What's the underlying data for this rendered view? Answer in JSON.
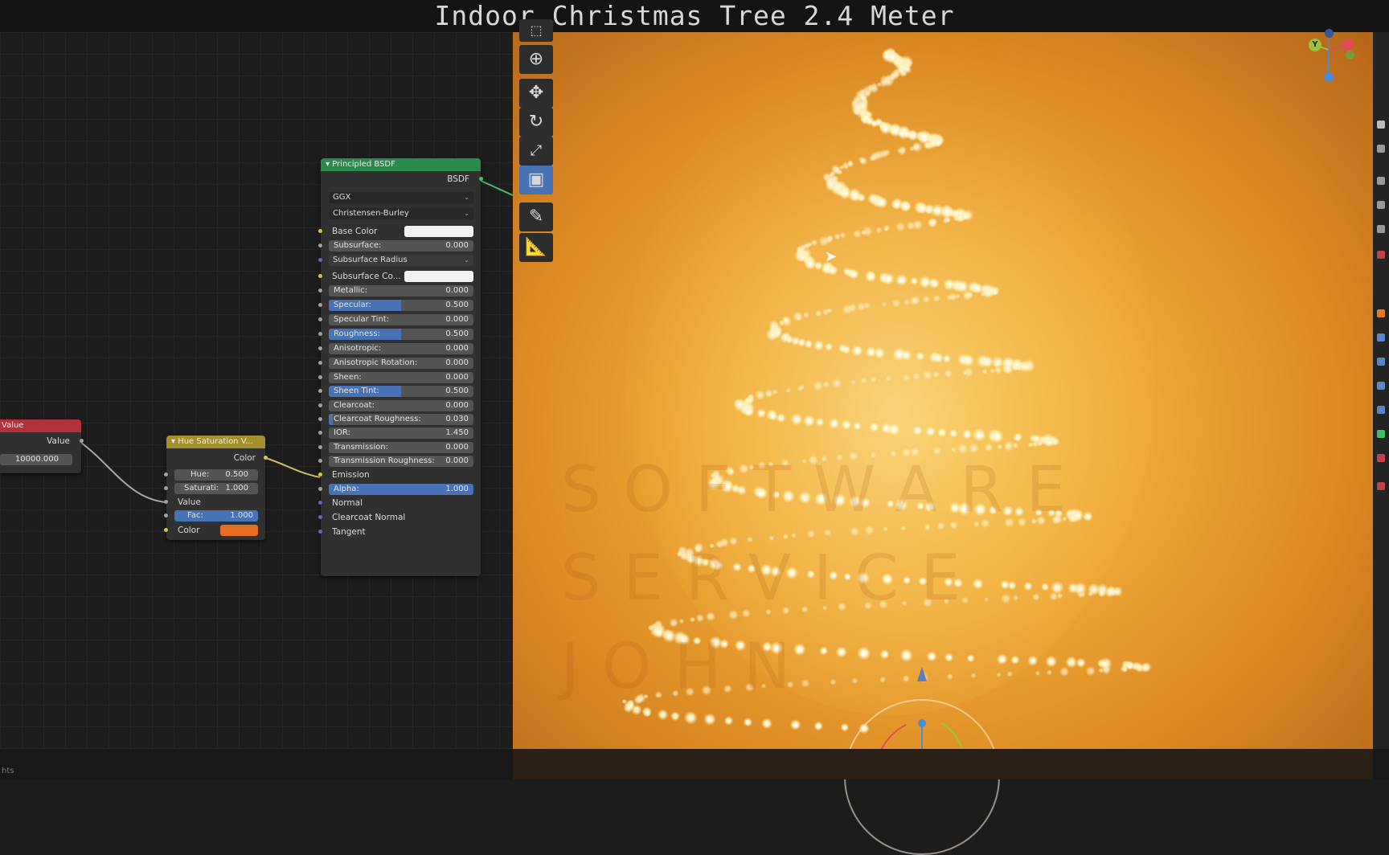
{
  "title": "Indoor Christmas Tree 2.4 Meter",
  "bottom_left_text": "hts",
  "watermark": {
    "line1": "SOFTWARE",
    "line2": "SERVICE",
    "line3": "JOHN"
  },
  "nodes": {
    "value_node": {
      "header": "Value",
      "output": "Value",
      "field_value": "10000.000"
    },
    "hue_sat_node": {
      "header": "Hue Saturation V...",
      "output": "Color",
      "hue_label": "Hue:",
      "hue_value": "0.500",
      "sat_label": "Saturati:",
      "sat_value": "1.000",
      "value_label": "Value",
      "fac_label": "Fac:",
      "fac_value": "1.000",
      "color_label": "Color"
    },
    "bsdf_node": {
      "header": "Principled BSDF",
      "output": "BSDF",
      "distribution": "GGX",
      "subsurface_method": "Christensen-Burley",
      "base_color_label": "Base Color",
      "subsurface_label": "Subsurface:",
      "subsurface_value": "0.000",
      "subsurface_radius_label": "Subsurface Radius",
      "subsurface_color_label": "Subsurface Co...",
      "metallic_label": "Metallic:",
      "metallic_value": "0.000",
      "specular_label": "Specular:",
      "specular_value": "0.500",
      "specular_tint_label": "Specular Tint:",
      "specular_tint_value": "0.000",
      "roughness_label": "Roughness:",
      "roughness_value": "0.500",
      "anisotropic_label": "Anisotropic:",
      "anisotropic_value": "0.000",
      "anisotropic_rotation_label": "Anisotropic Rotation:",
      "anisotropic_rotation_value": "0.000",
      "sheen_label": "Sheen:",
      "sheen_value": "0.000",
      "sheen_tint_label": "Sheen Tint:",
      "sheen_tint_value": "0.500",
      "clearcoat_label": "Clearcoat:",
      "clearcoat_value": "0.000",
      "clearcoat_roughness_label": "Clearcoat Roughness:",
      "clearcoat_roughness_value": "0.030",
      "ior_label": "IOR:",
      "ior_value": "1.450",
      "transmission_label": "Transmission:",
      "transmission_value": "0.000",
      "transmission_roughness_label": "Transmission Roughness:",
      "transmission_roughness_value": "0.000",
      "emission_label": "Emission",
      "alpha_label": "Alpha:",
      "alpha_value": "1.000",
      "normal_label": "Normal",
      "clearcoat_normal_label": "Clearcoat Normal",
      "tangent_label": "Tangent"
    }
  },
  "gizmo": {
    "y_label": "Y"
  },
  "colors": {
    "value_header": "#b2323c",
    "hue_header": "#a58f2b",
    "bsdf_header": "#2a8a4c",
    "accent": "#4772b3",
    "swatch_orange": "#e66c23",
    "swatch_white": "#f2f2f2"
  },
  "icons": [
    "select-box-icon",
    "cursor-icon",
    "move-icon",
    "rotate-icon",
    "scale-icon",
    "transform-icon",
    "annotate-icon",
    "measure-icon"
  ]
}
